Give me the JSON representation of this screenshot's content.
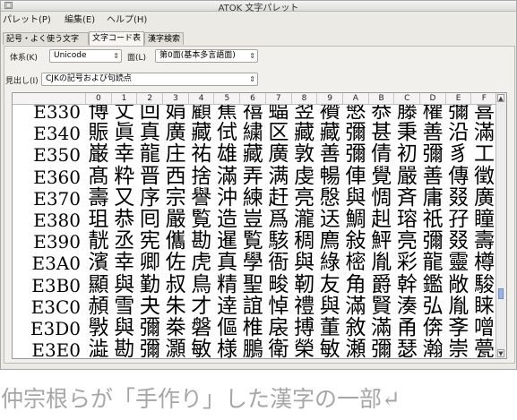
{
  "window": {
    "title": "ATOK 文字パレット",
    "sys_icon": "□"
  },
  "menu": [
    "パレット(P)",
    "編集(E)",
    "ヘルプ(H)"
  ],
  "tabs": [
    "記号・よく使う文字",
    "文字コード表",
    "漢字検索"
  ],
  "active_tab": 1,
  "controls": {
    "system_label": "体系(K)",
    "system_value": "Unicode",
    "plane_label": "面(L)",
    "plane_value": "第0面(基本多言語面)",
    "heading_label": "見出し(I)",
    "heading_value": "CJKの記号および句読点"
  },
  "grid": {
    "columns": [
      "0",
      "1",
      "2",
      "3",
      "4",
      "5",
      "6",
      "7",
      "8",
      "9",
      "A",
      "B",
      "C",
      "D",
      "E",
      "F"
    ],
    "rows": [
      {
        "label": "E330",
        "chars": [
          "博",
          "丈",
          "回",
          "娟",
          "顧",
          "蕉",
          "禧",
          "蝠",
          "翌",
          "襸",
          "慜",
          "恭",
          "藤",
          "權",
          "彌",
          "喜"
        ]
      },
      {
        "label": "E340",
        "chars": [
          "賑",
          "眞",
          "真",
          "廣",
          "藏",
          "侙",
          "繍",
          "区",
          "藏",
          "藏",
          "彌",
          "甚",
          "秉",
          "善",
          "沿",
          "滿"
        ]
      },
      {
        "label": "E350",
        "chars": [
          "巌",
          "幸",
          "龍",
          "庄",
          "祐",
          "雄",
          "藏",
          "廣",
          "敦",
          "善",
          "彌",
          "倩",
          "初",
          "彌",
          "豸",
          "工"
        ]
      },
      {
        "label": "E360",
        "chars": [
          "髙",
          "粋",
          "晋",
          "西",
          "捨",
          "滿",
          "弄",
          "满",
          "虔",
          "暢",
          "俥",
          "覺",
          "嚴",
          "善",
          "傳",
          "徵"
        ]
      },
      {
        "label": "E370",
        "chars": [
          "壽",
          "又",
          "序",
          "宗",
          "譽",
          "沖",
          "練",
          "赶",
          "亮",
          "慇",
          "與",
          "惆",
          "斉",
          "庸",
          "叕",
          "廣"
        ]
      },
      {
        "label": "E380",
        "chars": [
          "珇",
          "恭",
          "囘",
          "嚴",
          "覧",
          "造",
          "豈",
          "爲",
          "瀧",
          "迗",
          "鯛",
          "赳",
          "瑢",
          "祇",
          "孖",
          "瞳"
        ]
      },
      {
        "label": "E390",
        "chars": [
          "靗",
          "丞",
          "宪",
          "儶",
          "勘",
          "暹",
          "覧",
          "駭",
          "稠",
          "廌",
          "敍",
          "鮃",
          "亮",
          "彌",
          "叕",
          "壽"
        ]
      },
      {
        "label": "E3A0",
        "chars": [
          "濱",
          "幸",
          "卿",
          "佐",
          "虎",
          "真",
          "學",
          "衙",
          "與",
          "綠",
          "樒",
          "胤",
          "彩",
          "龍",
          "靈",
          "樽"
        ]
      },
      {
        "label": "E3B0",
        "chars": [
          "顯",
          "與",
          "勤",
          "叔",
          "鳥",
          "精",
          "聖",
          "畯",
          "靭",
          "友",
          "角",
          "爵",
          "幹",
          "鑑",
          "敞",
          "駿"
        ]
      },
      {
        "label": "E3C0",
        "chars": [
          "頳",
          "雪",
          "夬",
          "朱",
          "才",
          "逹",
          "誼",
          "悼",
          "禮",
          "與",
          "滿",
          "賢",
          "湊",
          "弘",
          "胤",
          "睐"
        ]
      },
      {
        "label": "E3D0",
        "chars": [
          "斅",
          "與",
          "彌",
          "桊",
          "磐",
          "傴",
          "椎",
          "扆",
          "搏",
          "董",
          "敘",
          "滿",
          "甬",
          "倴",
          "斈",
          "噌"
        ]
      },
      {
        "label": "E3E0",
        "chars": [
          "澁",
          "勘",
          "彌",
          "灝",
          "敏",
          "様",
          "鵬",
          "衛",
          "榮",
          "敏",
          "瀬",
          "彌",
          "瑟",
          "瀚",
          "崇",
          "甍"
        ]
      }
    ]
  },
  "caption": "仲宗根らが「手作り」した漢字の一部↵"
}
